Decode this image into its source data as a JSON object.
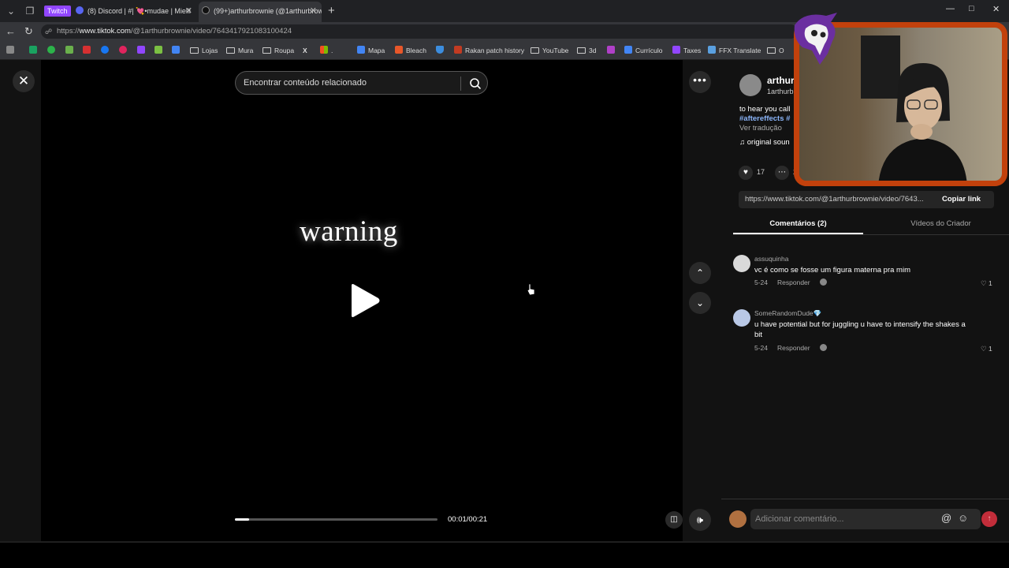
{
  "browser": {
    "twitch_badge": "Twitch",
    "tabs": [
      {
        "label": "(8) Discord | #| 💘•mudae | Mielli",
        "color": "#5865f2"
      },
      {
        "label": "(99+)arthurbrownie (@1arthurbrownie",
        "color": "#111111",
        "active": true
      }
    ],
    "new_tab": "+",
    "window_controls": [
      "—",
      "□",
      "✕"
    ],
    "url_prefix": "https://",
    "url_host": "www.tiktok.com",
    "url_path": "/@1arthurbrownie/video/7643417921083100424",
    "bookmarks": [
      {
        "label": "Lojas",
        "type": "folder"
      },
      {
        "label": "Mura",
        "type": "folder"
      },
      {
        "label": "Roupa",
        "type": "folder"
      },
      {
        "label": ".",
        "type": "site",
        "color": "#7fba00"
      },
      {
        "label": "Mapa",
        "type": "site",
        "color": "#4285f4"
      },
      {
        "label": "Bleach",
        "type": "site",
        "color": "#e8572a"
      },
      {
        "label": "Rakan patch history",
        "type": "site",
        "color": "#c23b22"
      },
      {
        "label": "YouTube",
        "type": "folder"
      },
      {
        "label": "3d",
        "type": "folder"
      },
      {
        "label": "Currículo",
        "type": "site",
        "color": "#4285f4"
      },
      {
        "label": "Taxes",
        "type": "site",
        "color": "#9146ff"
      },
      {
        "label": "FFX Translate",
        "type": "site",
        "color": "#5aa0e0"
      },
      {
        "label": "O",
        "type": "folder"
      }
    ]
  },
  "video": {
    "search_placeholder": "Encontrar conteúdo relacionado",
    "overlay_text": "warning",
    "time": "00:01/00:21",
    "progress": 0.07
  },
  "panel": {
    "username": "arthur",
    "handle": "1arthurb",
    "description": "to hear you call",
    "hashtags": "#aftereffects #",
    "translate": "Ver tradução",
    "sound": "original soun",
    "likes": "17",
    "comments_count": "2",
    "link": "https://www.tiktok.com/@1arthurbrownie/video/7643...",
    "copy_link": "Copiar link",
    "tab_comments": "Comentários (2)",
    "tab_creator": "Vídeos do Criador",
    "comment_placeholder": "Adicionar comentário...",
    "comments": [
      {
        "user": "assuquinha",
        "text": "vc é como se fosse um figura materna pra mim",
        "date": "5-24",
        "reply": "Responder",
        "likes": "1"
      },
      {
        "user": "SomeRandomDude💎",
        "text": "u have potential but for juggling u have to intensify the shakes a bit",
        "date": "5-24",
        "reply": "Responder",
        "likes": "1"
      }
    ]
  },
  "colors": {
    "cam_border": "#c2410c",
    "send_button": "#c22d3a",
    "hashtag": "#8ab4f8"
  }
}
